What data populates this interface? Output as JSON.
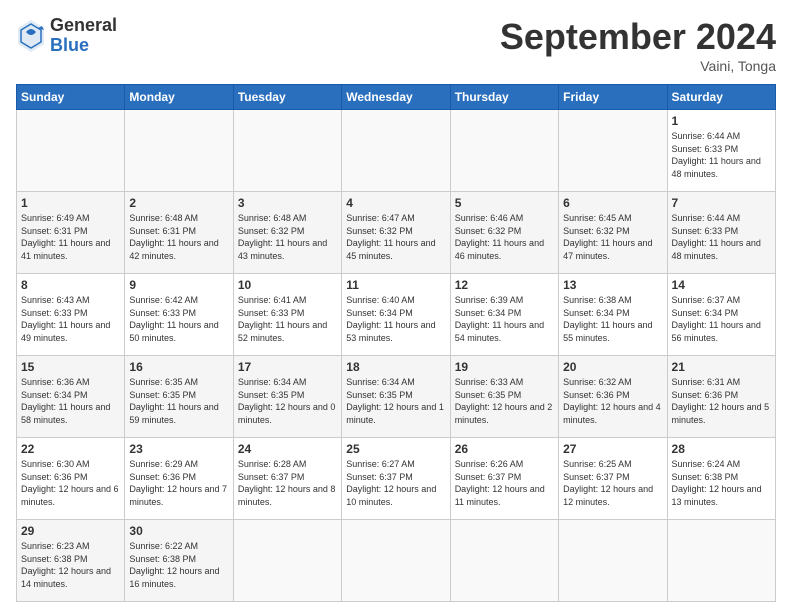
{
  "logo": {
    "general": "General",
    "blue": "Blue"
  },
  "header": {
    "title": "September 2024",
    "subtitle": "Vaini, Tonga"
  },
  "calendar": {
    "days": [
      "Sunday",
      "Monday",
      "Tuesday",
      "Wednesday",
      "Thursday",
      "Friday",
      "Saturday"
    ],
    "weeks": [
      [
        null,
        null,
        null,
        null,
        null,
        null,
        {
          "day": 1,
          "sunrise": "6:44 AM",
          "sunset": "6:33 PM",
          "daylight": "11 hours and 48 minutes."
        }
      ],
      [
        {
          "day": 1,
          "sunrise": "6:49 AM",
          "sunset": "6:31 PM",
          "daylight": "11 hours and 41 minutes."
        },
        {
          "day": 2,
          "sunrise": "6:48 AM",
          "sunset": "6:31 PM",
          "daylight": "11 hours and 42 minutes."
        },
        {
          "day": 3,
          "sunrise": "6:48 AM",
          "sunset": "6:32 PM",
          "daylight": "11 hours and 43 minutes."
        },
        {
          "day": 4,
          "sunrise": "6:47 AM",
          "sunset": "6:32 PM",
          "daylight": "11 hours and 45 minutes."
        },
        {
          "day": 5,
          "sunrise": "6:46 AM",
          "sunset": "6:32 PM",
          "daylight": "11 hours and 46 minutes."
        },
        {
          "day": 6,
          "sunrise": "6:45 AM",
          "sunset": "6:32 PM",
          "daylight": "11 hours and 47 minutes."
        },
        {
          "day": 7,
          "sunrise": "6:44 AM",
          "sunset": "6:33 PM",
          "daylight": "11 hours and 48 minutes."
        }
      ],
      [
        {
          "day": 8,
          "sunrise": "6:43 AM",
          "sunset": "6:33 PM",
          "daylight": "11 hours and 49 minutes."
        },
        {
          "day": 9,
          "sunrise": "6:42 AM",
          "sunset": "6:33 PM",
          "daylight": "11 hours and 50 minutes."
        },
        {
          "day": 10,
          "sunrise": "6:41 AM",
          "sunset": "6:33 PM",
          "daylight": "11 hours and 52 minutes."
        },
        {
          "day": 11,
          "sunrise": "6:40 AM",
          "sunset": "6:34 PM",
          "daylight": "11 hours and 53 minutes."
        },
        {
          "day": 12,
          "sunrise": "6:39 AM",
          "sunset": "6:34 PM",
          "daylight": "11 hours and 54 minutes."
        },
        {
          "day": 13,
          "sunrise": "6:38 AM",
          "sunset": "6:34 PM",
          "daylight": "11 hours and 55 minutes."
        },
        {
          "day": 14,
          "sunrise": "6:37 AM",
          "sunset": "6:34 PM",
          "daylight": "11 hours and 56 minutes."
        }
      ],
      [
        {
          "day": 15,
          "sunrise": "6:36 AM",
          "sunset": "6:34 PM",
          "daylight": "11 hours and 58 minutes."
        },
        {
          "day": 16,
          "sunrise": "6:35 AM",
          "sunset": "6:35 PM",
          "daylight": "11 hours and 59 minutes."
        },
        {
          "day": 17,
          "sunrise": "6:34 AM",
          "sunset": "6:35 PM",
          "daylight": "12 hours and 0 minutes."
        },
        {
          "day": 18,
          "sunrise": "6:34 AM",
          "sunset": "6:35 PM",
          "daylight": "12 hours and 1 minute."
        },
        {
          "day": 19,
          "sunrise": "6:33 AM",
          "sunset": "6:35 PM",
          "daylight": "12 hours and 2 minutes."
        },
        {
          "day": 20,
          "sunrise": "6:32 AM",
          "sunset": "6:36 PM",
          "daylight": "12 hours and 4 minutes."
        },
        {
          "day": 21,
          "sunrise": "6:31 AM",
          "sunset": "6:36 PM",
          "daylight": "12 hours and 5 minutes."
        }
      ],
      [
        {
          "day": 22,
          "sunrise": "6:30 AM",
          "sunset": "6:36 PM",
          "daylight": "12 hours and 6 minutes."
        },
        {
          "day": 23,
          "sunrise": "6:29 AM",
          "sunset": "6:36 PM",
          "daylight": "12 hours and 7 minutes."
        },
        {
          "day": 24,
          "sunrise": "6:28 AM",
          "sunset": "6:37 PM",
          "daylight": "12 hours and 8 minutes."
        },
        {
          "day": 25,
          "sunrise": "6:27 AM",
          "sunset": "6:37 PM",
          "daylight": "12 hours and 10 minutes."
        },
        {
          "day": 26,
          "sunrise": "6:26 AM",
          "sunset": "6:37 PM",
          "daylight": "12 hours and 11 minutes."
        },
        {
          "day": 27,
          "sunrise": "6:25 AM",
          "sunset": "6:37 PM",
          "daylight": "12 hours and 12 minutes."
        },
        {
          "day": 28,
          "sunrise": "6:24 AM",
          "sunset": "6:38 PM",
          "daylight": "12 hours and 13 minutes."
        }
      ],
      [
        {
          "day": 29,
          "sunrise": "6:23 AM",
          "sunset": "6:38 PM",
          "daylight": "12 hours and 14 minutes."
        },
        {
          "day": 30,
          "sunrise": "6:22 AM",
          "sunset": "6:38 PM",
          "daylight": "12 hours and 16 minutes."
        },
        null,
        null,
        null,
        null,
        null
      ]
    ]
  }
}
